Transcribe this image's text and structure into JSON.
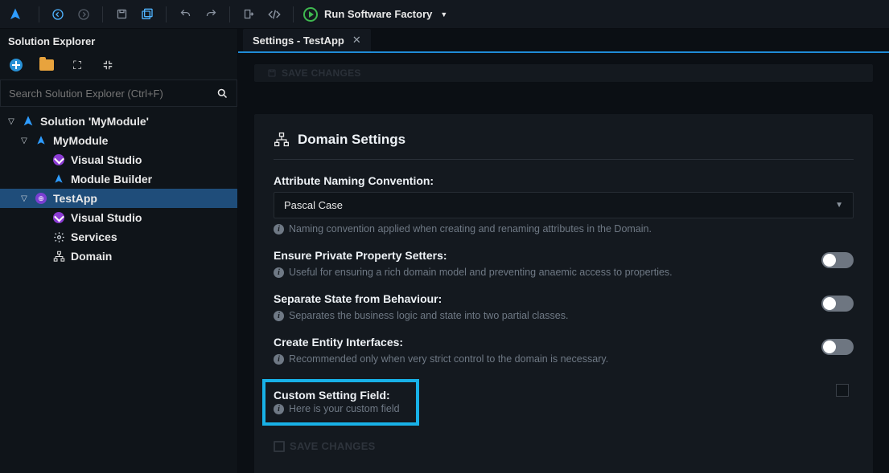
{
  "toolbar": {
    "run_label": "Run Software Factory"
  },
  "sidebar": {
    "title": "Solution Explorer",
    "search_placeholder": "Search Solution Explorer (Ctrl+F)",
    "tree": {
      "solution": "Solution 'MyModule'",
      "module": "MyModule",
      "module_children": {
        "vs": "Visual Studio",
        "builder": "Module Builder"
      },
      "app": "TestApp",
      "app_children": {
        "vs": "Visual Studio",
        "services": "Services",
        "domain": "Domain"
      }
    }
  },
  "tab": {
    "title": "Settings - TestApp"
  },
  "ghost_top": "SAVE CHANGES",
  "section": {
    "title": "Domain Settings",
    "attr_label": "Attribute Naming Convention:",
    "attr_value": "Pascal Case",
    "attr_hint": "Naming convention applied when creating and renaming attributes in the Domain.",
    "priv_label": "Ensure Private Property Setters:",
    "priv_hint": "Useful for ensuring a rich domain model and preventing anaemic access to properties.",
    "sep_label": "Separate State from Behaviour:",
    "sep_hint": "Separates the business logic and state into two partial classes.",
    "iface_label": "Create Entity Interfaces:",
    "iface_hint": "Recommended only when very strict control to the domain is necessary.",
    "custom_label": "Custom Setting Field:",
    "custom_hint": "Here is your custom field",
    "save_label": "SAVE CHANGES"
  }
}
